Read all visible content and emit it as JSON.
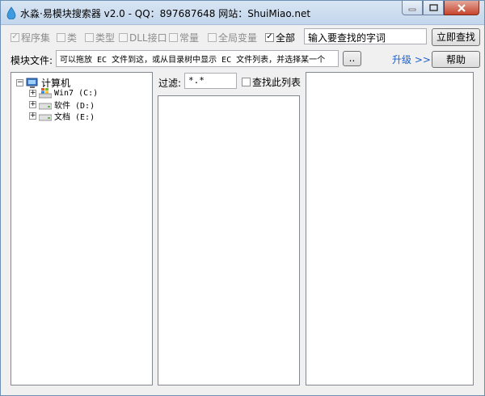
{
  "window": {
    "title": "水淼·易模块搜索器 v2.0 - QQ：897687648 网站：ShuiMiao.net",
    "icons": {
      "app": "water-drop-icon",
      "minimize": "minimize-icon",
      "maximize": "maximize-icon",
      "close": "close-icon"
    }
  },
  "options": [
    {
      "label": "程序集",
      "checked": true,
      "enabled": false
    },
    {
      "label": "类",
      "checked": false,
      "enabled": false
    },
    {
      "label": "类型",
      "checked": false,
      "enabled": false
    },
    {
      "label": "DLL接口",
      "checked": false,
      "enabled": false
    },
    {
      "label": "常量",
      "checked": false,
      "enabled": false
    },
    {
      "label": "全局变量",
      "checked": false,
      "enabled": false
    },
    {
      "label": "全部",
      "checked": true,
      "enabled": true
    }
  ],
  "search": {
    "value": "输入要查找的字词",
    "button_label": "立即查找"
  },
  "module": {
    "label": "模块文件:",
    "path_value": "可以拖放 EC 文件到这，或从目录树中显示 EC 文件列表，并选择某一个",
    "browse_label": "..",
    "upgrade_label": "升级 >>",
    "help_label": "帮助"
  },
  "tree": {
    "root": {
      "label": "计算机",
      "toggle": "−",
      "icon": "computer-icon"
    },
    "drives": [
      {
        "label": "Win7 (C:)",
        "toggle": "+",
        "icon": "windows-drive-icon"
      },
      {
        "label": "软件 (D:)",
        "toggle": "+",
        "icon": "drive-icon"
      },
      {
        "label": "文档 (E:)",
        "toggle": "+",
        "icon": "drive-icon"
      }
    ]
  },
  "filter": {
    "label": "过滤:",
    "value": "*.*",
    "checkbox_label": "查找此列表",
    "checkbox_checked": false
  },
  "colors": {
    "title_bar": "#c9dbef",
    "link": "#1e5fc8",
    "close_button": "#c7432b"
  }
}
